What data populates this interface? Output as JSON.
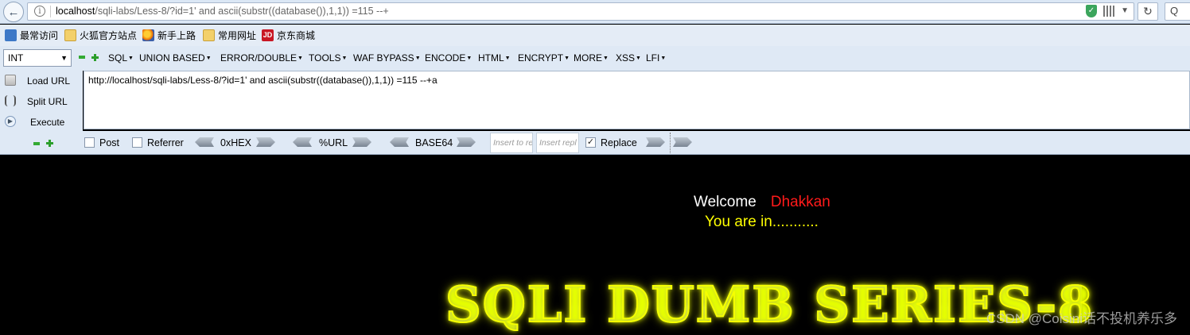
{
  "browser": {
    "url_host": "localhost",
    "url_path": "/sqli-labs/Less-8/?id=1' and ascii(substr((database()),1,1)) =115 --+",
    "search_placeholder": "Q"
  },
  "bookmarks": [
    {
      "label": "最常访问",
      "icon": "most-visited-icon"
    },
    {
      "label": "火狐官方站点",
      "icon": "folder-icon"
    },
    {
      "label": "新手上路",
      "icon": "firefox-icon"
    },
    {
      "label": "常用网址",
      "icon": "folder-icon"
    },
    {
      "label": "京东商城",
      "icon": "jd-icon",
      "icon_text": "JD"
    }
  ],
  "hackbar": {
    "type_select": "INT",
    "menus": [
      "SQL",
      "UNION BASED",
      "ERROR/DOUBLE",
      "TOOLS",
      "WAF BYPASS",
      "ENCODE",
      "HTML",
      "ENCRYPT",
      "MORE",
      "XSS",
      "LFI"
    ],
    "actions": {
      "load": "Load URL",
      "split": "Split URL",
      "execute": "Execute"
    },
    "textarea_value": "http://localhost/sqli-labs/Less-8/?id=1' and ascii(substr((database()),1,1)) =115 --+a",
    "options": {
      "post_label": "Post",
      "post_checked": false,
      "referrer_label": "Referrer",
      "referrer_checked": false,
      "hex_label": "0xHEX",
      "url_label": "%URL",
      "base64_label": "BASE64",
      "insert_placeholder": "Insert to re",
      "replace_placeholder": "Insert repl",
      "replace_label": "Replace",
      "replace_checked": true
    }
  },
  "page": {
    "welcome": "Welcome",
    "username": "Dhakkan",
    "status": "You are in...........",
    "banner": "SQLI DUMB SERIES-8",
    "watermark": "CSDN @Coisini话不投机养乐多"
  },
  "colors": {
    "page_background": "#000000",
    "username": "#ff1a1a",
    "status": "#ffff00",
    "banner_glow": "#f5ff00"
  }
}
